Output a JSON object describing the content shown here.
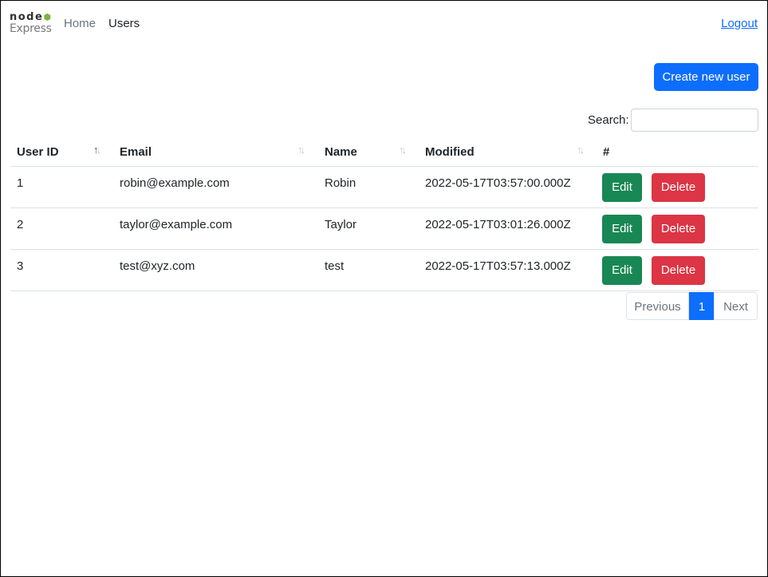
{
  "navbar": {
    "logo_top": "node",
    "logo_bottom": "Express",
    "links": [
      "Home",
      "Users"
    ],
    "logout": "Logout"
  },
  "actions": {
    "create_label": "Create new user"
  },
  "search": {
    "label": "Search:",
    "value": ""
  },
  "table": {
    "headers": [
      "User ID",
      "Email",
      "Name",
      "Modified",
      "#"
    ],
    "rows": [
      {
        "id": "1",
        "email": "robin@example.com",
        "name": "Robin",
        "modified": "2022-05-17T03:57:00.000Z"
      },
      {
        "id": "2",
        "email": "taylor@example.com",
        "name": "Taylor",
        "modified": "2022-05-17T03:01:26.000Z"
      },
      {
        "id": "3",
        "email": "test@xyz.com",
        "name": "test",
        "modified": "2022-05-17T03:57:13.000Z"
      }
    ],
    "edit_label": "Edit",
    "delete_label": "Delete",
    "sort_icon": "sort-arrows-icon"
  },
  "pagination": {
    "previous": "Previous",
    "current": "1",
    "next": "Next"
  },
  "colors": {
    "primary": "#0d6efd",
    "success": "#198754",
    "danger": "#dc3545"
  }
}
